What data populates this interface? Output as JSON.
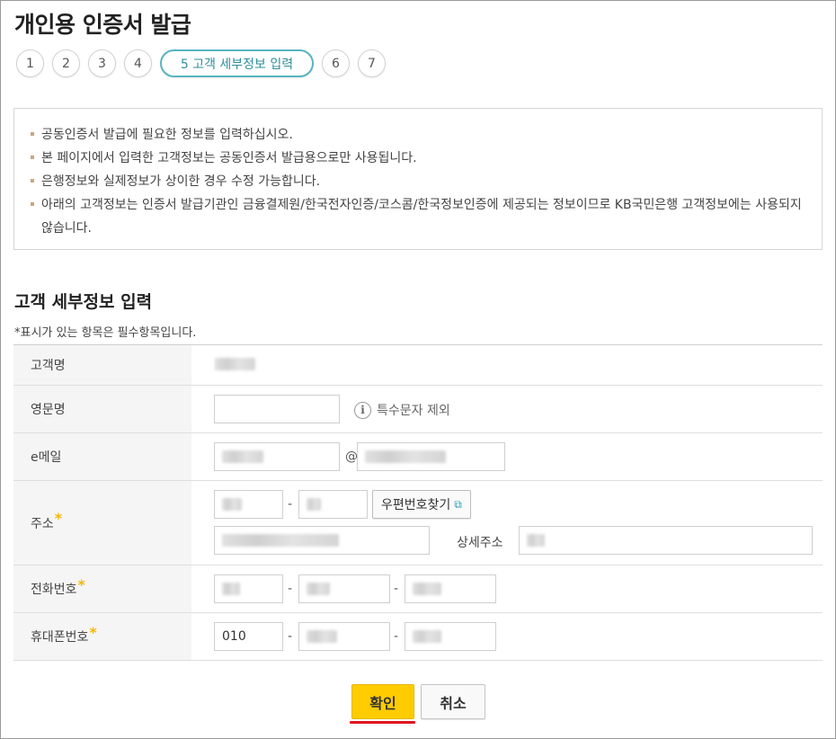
{
  "page": {
    "title": "개인용 인증서 발급"
  },
  "steps": {
    "items": [
      "1",
      "2",
      "3",
      "4",
      "5 고객 세부정보 입력",
      "6",
      "7"
    ],
    "active_index": 4
  },
  "notice": {
    "items": [
      "공동인증서 발급에 필요한 정보를 입력하십시오.",
      "본 페이지에서 입력한 고객정보는 공동인증서 발급용으로만 사용됩니다.",
      "은행정보와 실제정보가 상이한 경우 수정 가능합니다.",
      "아래의 고객정보는 인증서 발급기관인 금융결제원/한국전자인증/코스콤/한국정보인증에 제공되는 정보이므로 KB국민은행 고객정보에는 사용되지 않습니다."
    ]
  },
  "section": {
    "title": "고객 세부정보 입력",
    "required_note": "*표시가 있는 항목은 필수항목입니다."
  },
  "form": {
    "customer_name_label": "고객명",
    "english_name_label": "영문명",
    "english_name_hint": "특수문자 제외",
    "email_label": "e메일",
    "email_at": "@",
    "address_label": "주소",
    "zip_dash": "-",
    "zip_button": "우편번호찾기",
    "detail_address_label": "상세주소",
    "phone_label": "전화번호",
    "mobile_label": "휴대폰번호",
    "mobile_prefix": "010",
    "dash": "-",
    "required_mark": "*"
  },
  "buttons": {
    "confirm": "확인",
    "cancel": "취소"
  },
  "colors": {
    "accent": "#ffcc00",
    "step_active": "#59b4bf",
    "required": "#f5b800",
    "underline": "#e0161e"
  }
}
